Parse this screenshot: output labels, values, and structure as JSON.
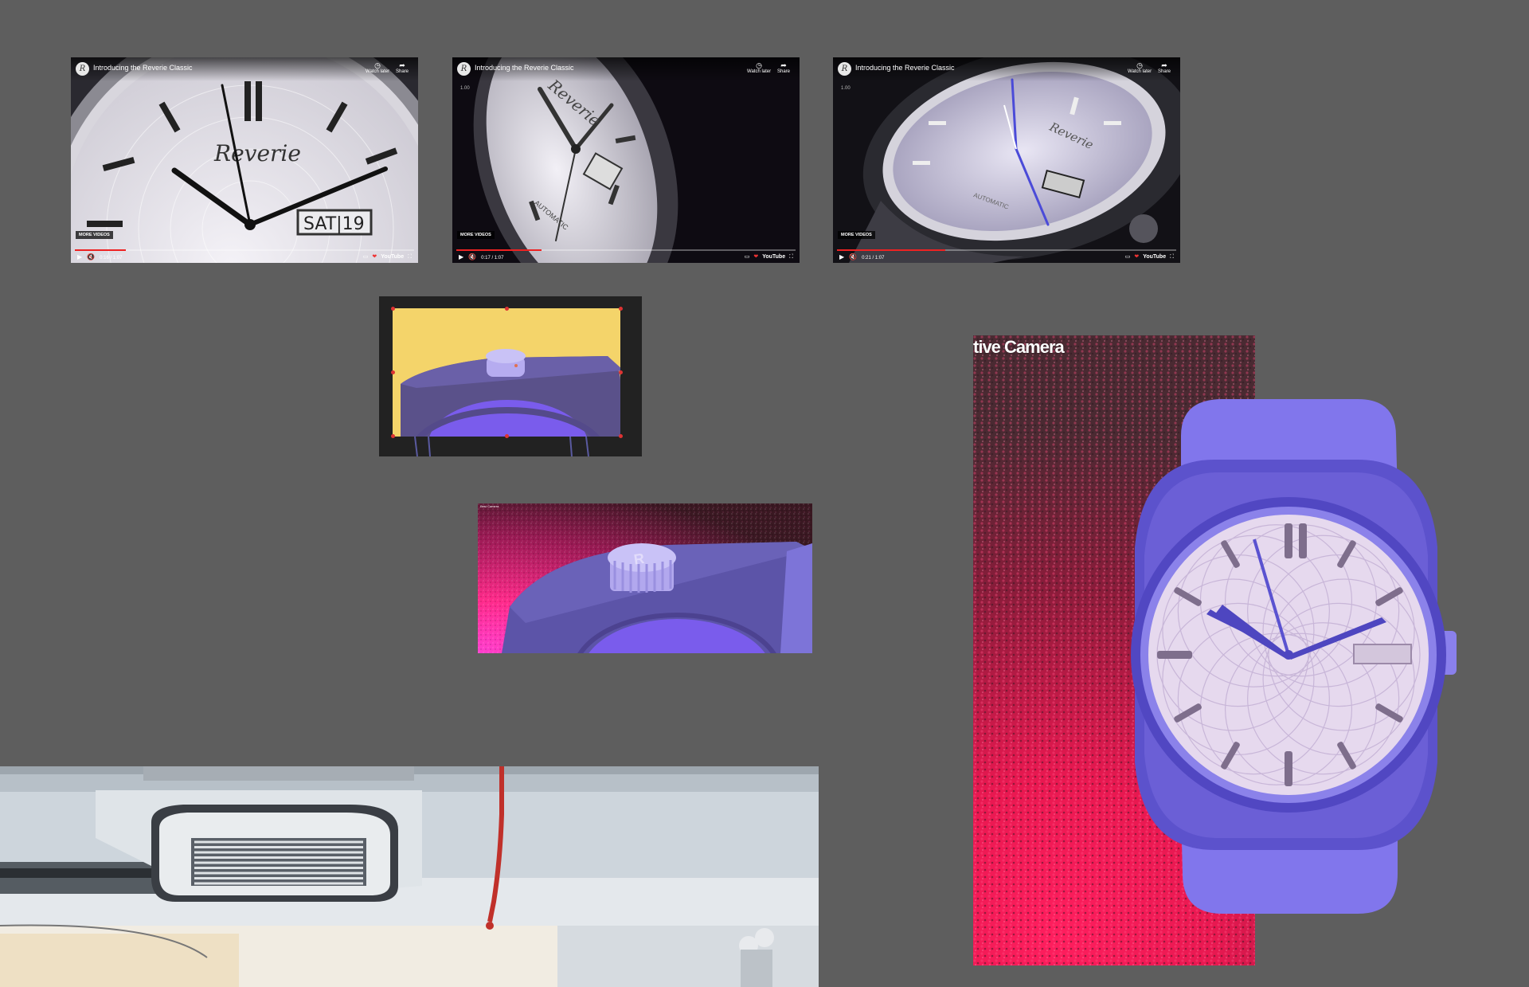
{
  "videos": [
    {
      "title": "Introducing the Reverie Classic",
      "channel_icon": "R",
      "watch_later": "Watch later",
      "share": "Share",
      "more_videos": "MORE VIDEOS",
      "time": "0:16 / 1:07",
      "brand": "YouTube",
      "dial_text": "Reverie",
      "date_window": "SAT|19",
      "progress": 0.15
    },
    {
      "title": "Introducing the Reverie Classic",
      "channel_icon": "R",
      "watch_later": "Watch later",
      "share": "Share",
      "more_videos": "MORE VIDEOS",
      "time": "0:17 / 1:07",
      "brand": "YouTube",
      "tag": "1.00",
      "dial_text": "Reverie",
      "auto_text": "AUTOMATIC",
      "progress": 0.25
    },
    {
      "title": "Introducing the Reverie Classic",
      "channel_icon": "R",
      "watch_later": "Watch later",
      "share": "Share",
      "more_videos": "MORE VIDEOS",
      "time": "0:21 / 1:07",
      "brand": "YouTube",
      "tag": "1.00",
      "dial_text": "Reverie",
      "auto_text": "AUTOMATIC",
      "progress": 0.32
    }
  ],
  "render": {
    "label": "Best Camera"
  },
  "camera": {
    "title": "tive Camera"
  },
  "colors": {
    "background": "#5e5e5e",
    "watch_case": "#6b5fd6",
    "watch_strap": "#8176ec",
    "dial": "#e6d9ee",
    "hands": "#5048c4",
    "editor_bg": "#f4d46a"
  }
}
